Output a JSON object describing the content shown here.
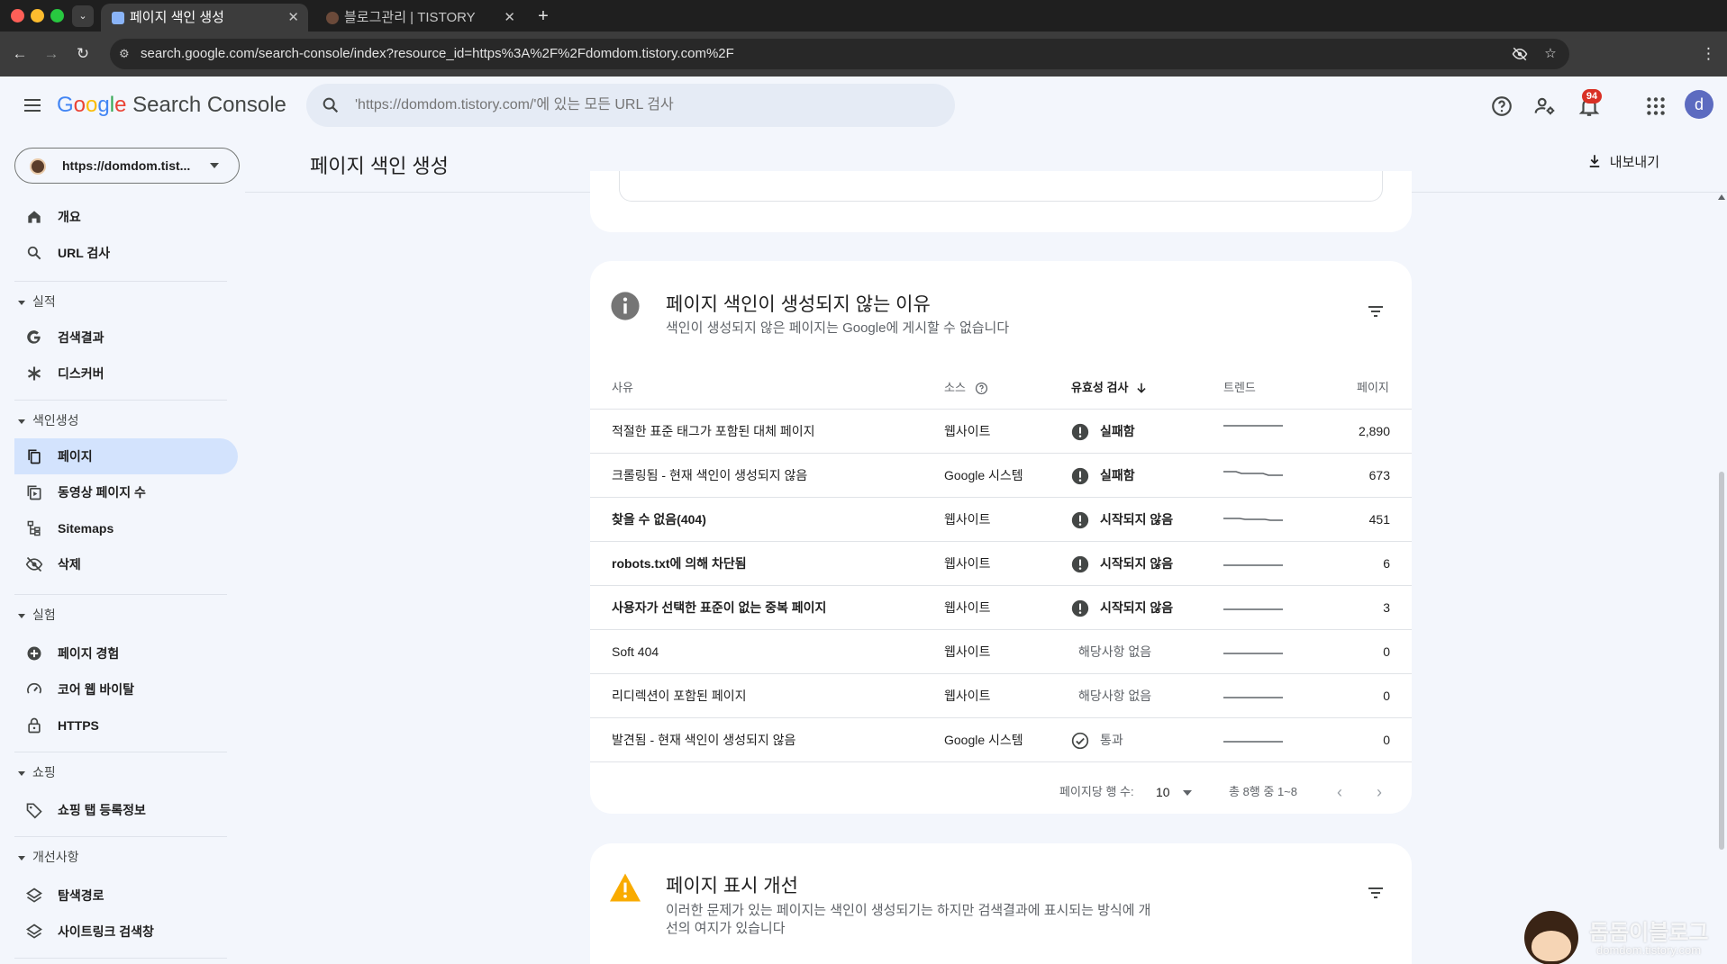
{
  "browser": {
    "tabs": [
      {
        "title": "페이지 색인 생성",
        "active": true
      },
      {
        "title": "블로그관리 | TISTORY",
        "active": false
      }
    ],
    "url": "search.google.com/search-console/index?resource_id=https%3A%2F%2Fdomdom.tistory.com%2F"
  },
  "header": {
    "logo_google": "Google",
    "logo_product": "Search Console",
    "search_placeholder": "'https://domdom.tistory.com/'에 있는 모든 URL 검사",
    "notification_count": "94",
    "avatar_letter": "d"
  },
  "sidebar": {
    "property": "https://domdom.tist...",
    "top_items": [
      {
        "label": "개요",
        "icon": "home-icon"
      },
      {
        "label": "URL 검사",
        "icon": "search-icon"
      }
    ],
    "sections": [
      {
        "title": "실적",
        "items": [
          {
            "label": "검색결과",
            "icon": "google-g-icon"
          },
          {
            "label": "디스커버",
            "icon": "asterisk-icon"
          }
        ]
      },
      {
        "title": "색인생성",
        "items": [
          {
            "label": "페이지",
            "icon": "pages-icon",
            "active": true
          },
          {
            "label": "동영상 페이지 수",
            "icon": "video-pages-icon"
          },
          {
            "label": "Sitemaps",
            "icon": "sitemap-icon"
          },
          {
            "label": "삭제",
            "icon": "visibility-off-icon"
          }
        ]
      },
      {
        "title": "실험",
        "items": [
          {
            "label": "페이지 경험",
            "icon": "add-circle-icon"
          },
          {
            "label": "코어 웹 바이탈",
            "icon": "speed-icon"
          },
          {
            "label": "HTTPS",
            "icon": "lock-icon"
          }
        ]
      },
      {
        "title": "쇼핑",
        "items": [
          {
            "label": "쇼핑 탭 등록정보",
            "icon": "tag-icon"
          }
        ]
      },
      {
        "title": "개선사항",
        "items": [
          {
            "label": "탐색경로",
            "icon": "layers-icon"
          },
          {
            "label": "사이트링크 검색창",
            "icon": "layers-icon"
          }
        ]
      }
    ]
  },
  "page": {
    "title": "페이지 색인 생성",
    "export_label": "내보내기"
  },
  "reasons_card": {
    "title": "페이지 색인이 생성되지 않는 이유",
    "subtitle": "색인이 생성되지 않은 페이지는 Google에 게시할 수 없습니다",
    "columns": {
      "reason": "사유",
      "source": "소스",
      "validation": "유효성 검사",
      "trend": "트렌드",
      "pages": "페이지"
    },
    "rows": [
      {
        "reason": "적절한 표준 태그가 포함된 대체 페이지",
        "source": "웹사이트",
        "validation": "실패함",
        "status": "error",
        "pages": "2,890",
        "bold": false
      },
      {
        "reason": "크롤링됨 - 현재 색인이 생성되지 않음",
        "source": "Google 시스템",
        "validation": "실패함",
        "status": "error",
        "pages": "673",
        "bold": false
      },
      {
        "reason": "찾을 수 없음(404)",
        "source": "웹사이트",
        "validation": "시작되지 않음",
        "status": "error",
        "pages": "451",
        "bold": true
      },
      {
        "reason": "robots.txt에 의해 차단됨",
        "source": "웹사이트",
        "validation": "시작되지 않음",
        "status": "error",
        "pages": "6",
        "bold": true
      },
      {
        "reason": "사용자가 선택한 표준이 없는 중복 페이지",
        "source": "웹사이트",
        "validation": "시작되지 않음",
        "status": "error",
        "pages": "3",
        "bold": true
      },
      {
        "reason": "Soft 404",
        "source": "웹사이트",
        "validation": "해당사항 없음",
        "status": "na",
        "pages": "0",
        "bold": false
      },
      {
        "reason": "리디렉션이 포함된 페이지",
        "source": "웹사이트",
        "validation": "해당사항 없음",
        "status": "na",
        "pages": "0",
        "bold": false
      },
      {
        "reason": "발견됨 - 현재 색인이 생성되지 않음",
        "source": "Google 시스템",
        "validation": "통과",
        "status": "passed",
        "pages": "0",
        "bold": false
      }
    ],
    "pagination": {
      "rows_per_page_label": "페이지당 행 수:",
      "rows_per_page": "10",
      "range": "총 8행 중 1~8"
    }
  },
  "enhancement_card": {
    "title": "페이지 표시 개선",
    "subtitle_line1": "이러한 문제가 있는 페이지는 색인이 생성되기는 하지만 검색결과에 표시되는 방식에 개",
    "subtitle_line2": "선의 여지가 있습니다"
  },
  "watermark": {
    "title": "돔돔이블로그",
    "subtitle": "domdom.tistory.com"
  },
  "colors": {
    "accent": "#0b57d0",
    "active_nav": "#d3e3fd",
    "error": "#444746",
    "warning": "#f9ab00",
    "background": "#f3f6fc"
  }
}
